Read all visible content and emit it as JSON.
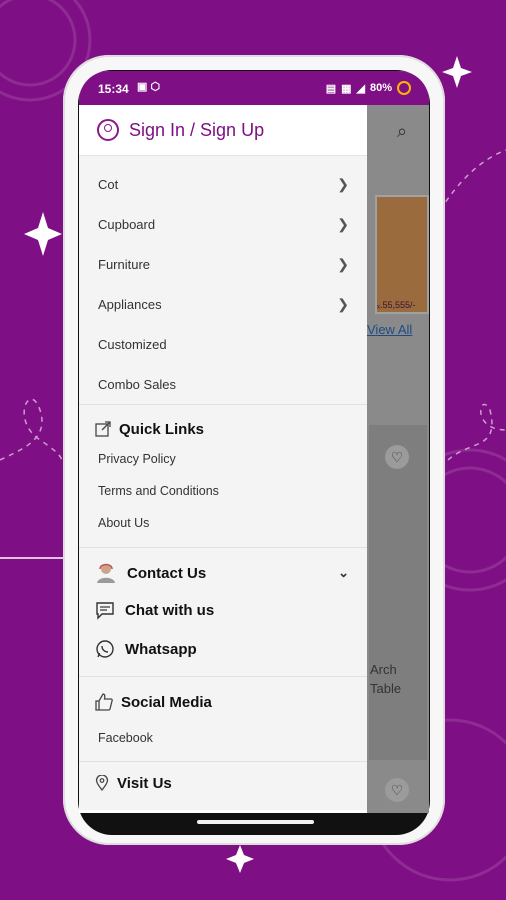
{
  "status_bar": {
    "time": "15:34",
    "right_icons": "⁴⁵ᴳ",
    "battery": "80%"
  },
  "drawer": {
    "sign_in_label": "Sign In / Sign Up",
    "categories": [
      {
        "label": "Cot",
        "has_submenu": true
      },
      {
        "label": "Cupboard",
        "has_submenu": true
      },
      {
        "label": "Furniture",
        "has_submenu": true
      },
      {
        "label": "Appliances",
        "has_submenu": true
      },
      {
        "label": "Customized",
        "has_submenu": false
      },
      {
        "label": "Combo Sales",
        "has_submenu": false
      }
    ],
    "quick_links": {
      "title": "Quick Links",
      "items": [
        "Privacy Policy",
        "Terms and Conditions",
        "About Us"
      ]
    },
    "contact": {
      "title": "Contact Us",
      "chat_label": "Chat with us",
      "whatsapp_label": "Whatsapp"
    },
    "social": {
      "title": "Social Media",
      "items": [
        "Facebook"
      ]
    },
    "visit": {
      "title": "Visit Us"
    }
  },
  "background_app": {
    "view_all": "View All",
    "price_snippet": "ₓ.55,555/-",
    "product_name_line1": "Arch",
    "product_name_line2": "Table"
  },
  "colors": {
    "brand": "#7f0f85",
    "drawer_bg": "#ffffff",
    "section_bg": "#f4f4f4"
  }
}
